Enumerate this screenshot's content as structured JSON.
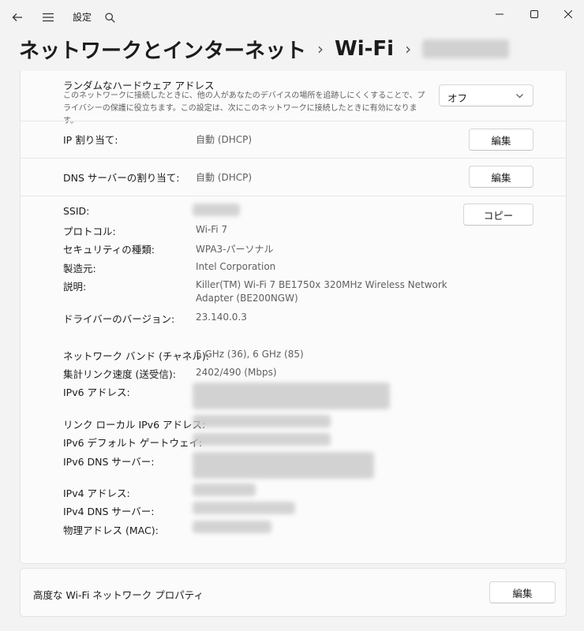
{
  "titlebar": {
    "back_icon": "arrow-left-icon",
    "menu_icon": "hamburger-icon",
    "app_title": "設定",
    "search_icon": "search-icon"
  },
  "breadcrumb": {
    "items": [
      "ネットワークとインターネット",
      "Wi-Fi"
    ],
    "separator": "›"
  },
  "random_hw": {
    "title": "ランダムなハードウェア アドレス",
    "description": "このネットワークに接続したときに、他の人があなたのデバイスの場所を追跡しにくくすることで、プライバシーの保護に役立ちます。この設定は、次にこのネットワークに接続したときに有効になります。",
    "select_value": "オフ"
  },
  "ip_assign": {
    "label": "IP 割り当て:",
    "value": "自動 (DHCP)",
    "button": "編集"
  },
  "dns_assign": {
    "label": "DNS サーバーの割り当て:",
    "value": "自動 (DHCP)",
    "button": "編集"
  },
  "properties": {
    "copy_button": "コピー",
    "ssid_label": "SSID:",
    "protocol_label": "プロトコル:",
    "protocol_value": "Wi-Fi 7",
    "security_label": "セキュリティの種類:",
    "security_value": "WPA3-パーソナル",
    "manufacturer_label": "製造元:",
    "manufacturer_value": "Intel Corporation",
    "description_label": "説明:",
    "description_value_line1": "Killer(TM) Wi-Fi 7 BE1750x 320MHz Wireless Network",
    "description_value_line2": "Adapter (BE200NGW)",
    "driver_label": "ドライバーのバージョン:",
    "driver_value": "23.140.0.3",
    "band_label": "ネットワーク バンド (チャネル):",
    "band_value": "5 GHz (36), 6 GHz (85)",
    "link_speed_label": "集計リンク速度 (送受信):",
    "link_speed_value": "2402/490 (Mbps)",
    "ipv6_label": "IPv6 アドレス:",
    "linklocal_label": "リンク ローカル IPv6 アドレス:",
    "ipv6_gateway_label": "IPv6 デフォルト ゲートウェイ:",
    "ipv6_dns_label": "IPv6 DNS サーバー:",
    "ipv4_label": "IPv4 アドレス:",
    "ipv4_dns_label": "IPv4 DNS サーバー:",
    "mac_label": "物理アドレス (MAC):"
  },
  "advanced": {
    "label": "高度な Wi-Fi ネットワーク プロパティ",
    "button": "編集"
  }
}
